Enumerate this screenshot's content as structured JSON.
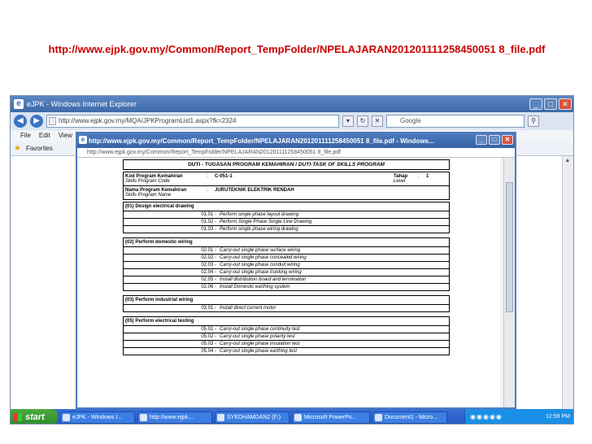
{
  "slide": {
    "title": "http://www.ejpk.gov.my/Common/Report_TempFolder/NPELAJARAN201201111258450051 8_file.pdf"
  },
  "ie": {
    "window_title": "eJPK - Windows Internet Explorer",
    "address": "http://www.ejpk.gov.my/MQA/JPKProgramList1.aspx?fk=2324",
    "search_placeholder": "Google",
    "menu": [
      "File",
      "Edit",
      "View"
    ],
    "favorites_label": "Favorites"
  },
  "popup": {
    "title": "http://www.ejpk.gov.my/Common/Report_TempFolder/NPELAJARAN201201111258450051 8_file.pdf - Windows...",
    "address": "http://www.ejpk.gov.my/Common/Report_TempFolder/NPELAJARAN201201111258450051 8_file.pdf"
  },
  "document": {
    "header_malay": "DUTI - TUGASAN PROGRAM KEMAHIRAN /",
    "header_english": "DUTI-TASK OF SKILLS PROGRAM",
    "kod_label": "Kod Program Kemahiran",
    "kod_label_en": "Skills Program Code",
    "kod_value": "C-051-1",
    "tahap_label": "Tahap",
    "tahap_label_en": "Level",
    "tahap_value": "1",
    "nama_label": "Nama Program Kemahiran",
    "nama_label_en": "Skills Program Name",
    "nama_value": "JURUTEKNIK ELEKTRIK RENDAH",
    "colon": ":",
    "sections": [
      {
        "title": "(01) Design electrical drawing",
        "tasks": [
          {
            "code": "01.01 -",
            "text": "Perform single phase layout drawing"
          },
          {
            "code": "01.02 -",
            "text": "Perform Single Phase Single Line Drawing"
          },
          {
            "code": "01.03 -",
            "text": "Perform single phase wiring drawing"
          }
        ]
      },
      {
        "title": "(02) Perform domestic wiring",
        "tasks": [
          {
            "code": "02.01 -",
            "text": "Carry-out single phase surface wiring"
          },
          {
            "code": "02.02 -",
            "text": "Carry-out single phase concealed wiring"
          },
          {
            "code": "02.03 -",
            "text": "Carry-out single phase conduit wiring"
          },
          {
            "code": "02.04 -",
            "text": "Carry-out single phase trunking wiring"
          },
          {
            "code": "02.05 -",
            "text": "Install distribution board and termination"
          },
          {
            "code": "02.06 -",
            "text": "Install Domestic earthing system"
          }
        ]
      },
      {
        "title": "(03) Perform industrial wiring",
        "tasks": [
          {
            "code": "03.01 -",
            "text": "Install direct current motor"
          }
        ]
      },
      {
        "title": "(05) Perform electrical testing",
        "tasks": [
          {
            "code": "05.01 -",
            "text": "Carry-out single phase continuity test"
          },
          {
            "code": "05.02 -",
            "text": "Carry-out single phase polarity test"
          },
          {
            "code": "05.03 -",
            "text": "Carry-out single phase insulation test"
          },
          {
            "code": "05.04 -",
            "text": "Carry-out single phase earthing test"
          }
        ]
      }
    ]
  },
  "taskbar": {
    "start_label": "start",
    "items": [
      "eJPK - Windows I...",
      "http://www.ejpk....",
      "SYEDHAMDAN2 (F:)",
      "Microsoft PowerPo...",
      "Document1 - Micro..."
    ],
    "clock": "12:59 PM"
  }
}
